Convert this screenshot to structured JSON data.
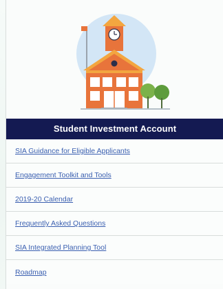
{
  "panel": {
    "illustration": "school-building-icon",
    "banner_title": "Student Investment Account",
    "links": [
      {
        "label": "SIA Guidance for Eligible Applicants"
      },
      {
        "label": "Engagement Toolkit and Tools"
      },
      {
        "label": "2019-20 Calendar"
      },
      {
        "label": "Frequently Asked Questions"
      },
      {
        "label": "SIA Integrated Planning Tool"
      },
      {
        "label": "Roadmap"
      }
    ]
  },
  "colors": {
    "banner_bg": "#141a52",
    "link": "#3a5fb0",
    "building": "#e8743b",
    "circle": "#cfe3f4"
  }
}
